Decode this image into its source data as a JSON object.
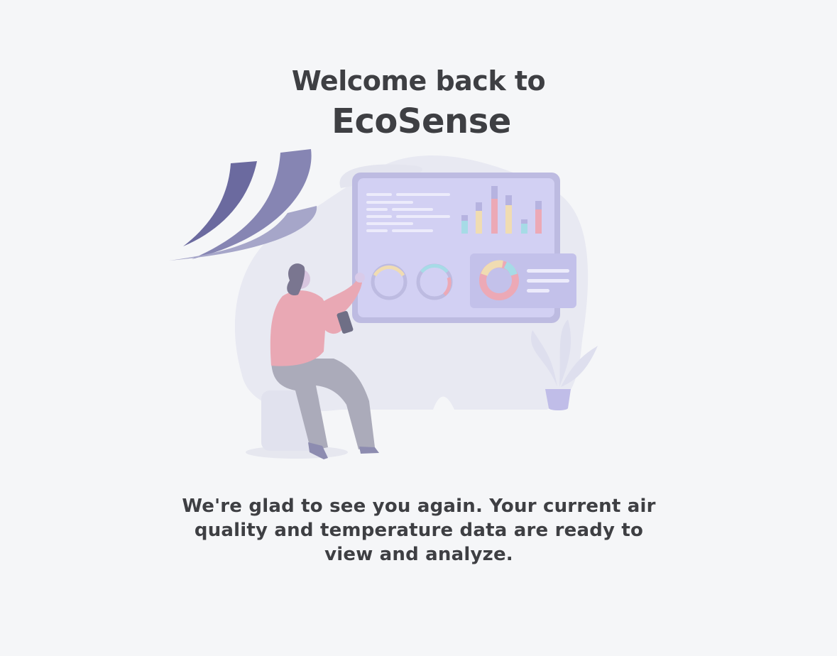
{
  "welcome": {
    "line1": "Welcome back to",
    "app_name": "EcoSense"
  },
  "message": {
    "text": "We're glad to see you again. Your current air quality and temperature data are ready to view and analyze."
  },
  "illustration": {
    "icon": "dashboard-illustration",
    "colors": {
      "background": "#f5f6f8",
      "text": "#3e3f43",
      "blob": "#e7e8f1",
      "screen": "#cfcdf0",
      "screen_frame": "#bcbadf",
      "swoosh": "#6c6b9e",
      "sweater": "#e9a6b2",
      "pants": "#a9a9b8"
    }
  }
}
